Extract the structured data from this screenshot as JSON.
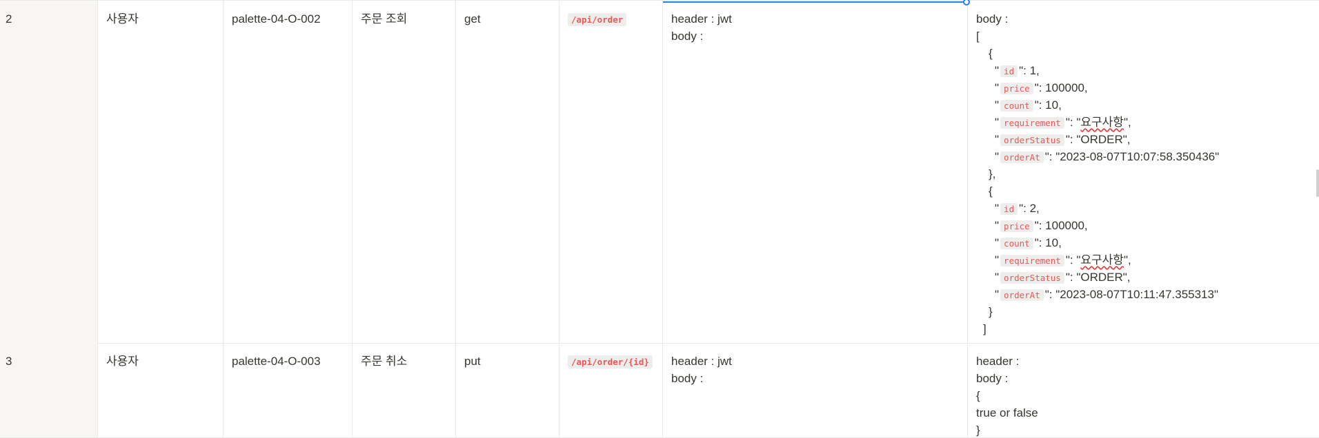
{
  "rows": [
    {
      "no": "2",
      "actor": "사용자",
      "id": "palette-04-O-002",
      "name": "주문 조회",
      "method": "get",
      "path": "/api/order",
      "request": [
        "header : jwt",
        "body :"
      ],
      "response": {
        "head": [
          "body :",
          "["
        ],
        "items": [
          {
            "fields": [
              {
                "key": "id",
                "val": ": 1,"
              },
              {
                "key": "price",
                "val": ": 100000,"
              },
              {
                "key": "count",
                "val": ": 10,"
              },
              {
                "key": "requirement",
                "val_pre": ": \"",
                "val_word": "요구사항",
                "val_post": "\","
              },
              {
                "key": "orderStatus",
                "val": ": \"ORDER\","
              },
              {
                "key": "orderAt",
                "val": ": \"2023-08-07T10:07:58.350436\""
              }
            ],
            "close": "},"
          },
          {
            "fields": [
              {
                "key": "id",
                "val": ": 2,"
              },
              {
                "key": "price",
                "val": ": 100000,"
              },
              {
                "key": "count",
                "val": ": 10,"
              },
              {
                "key": "requirement",
                "val_pre": ": \"",
                "val_word": "요구사항",
                "val_post": "\","
              },
              {
                "key": "orderStatus",
                "val": ": \"ORDER\","
              },
              {
                "key": "orderAt",
                "val": ": \"2023-08-07T10:11:47.355313\""
              }
            ],
            "close": "}"
          }
        ],
        "open": "{",
        "quote": "\"",
        "end": "]"
      }
    },
    {
      "no": "3",
      "actor": "사용자",
      "id": "palette-04-O-003",
      "name": "주문 취소",
      "method": "put",
      "path": "/api/order/{id}",
      "request": [
        "header : jwt",
        "body :"
      ],
      "response_lines": [
        "header :",
        "body :",
        "{",
        "true or false",
        "}"
      ]
    }
  ]
}
